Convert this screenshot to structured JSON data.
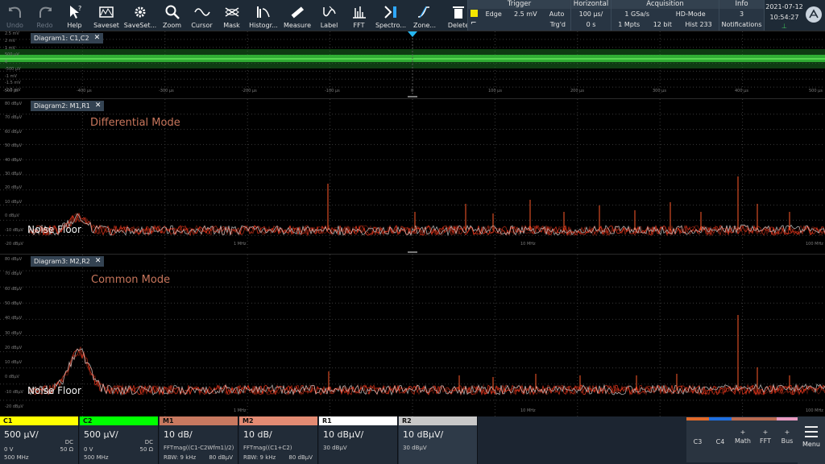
{
  "toolbar": {
    "buttons": [
      {
        "label": "Undo",
        "icon": "undo-icon"
      },
      {
        "label": "Redo",
        "icon": "redo-icon"
      },
      {
        "label": "Help",
        "icon": "help-cursor-icon"
      },
      {
        "label": "Saveset",
        "icon": "saveset-icon"
      },
      {
        "label": "SaveSet...",
        "icon": "saveset-gear-icon"
      },
      {
        "label": "Zoom",
        "icon": "zoom-icon"
      },
      {
        "label": "Cursor",
        "icon": "cursor-icon"
      },
      {
        "label": "Mask",
        "icon": "mask-icon"
      },
      {
        "label": "Histogr...",
        "icon": "histogram-icon"
      },
      {
        "label": "Measure",
        "icon": "measure-ruler-icon"
      },
      {
        "label": "Label",
        "icon": "label-icon"
      },
      {
        "label": "FFT",
        "icon": "fft-icon"
      },
      {
        "label": "Spectro...",
        "icon": "spectrogram-icon"
      },
      {
        "label": "Zone...",
        "icon": "zone-trigger-icon"
      },
      {
        "label": "Delete",
        "icon": "delete-trash-icon"
      }
    ],
    "trigger": {
      "title": "Trigger",
      "type": "Edge",
      "level": "2.5 mV",
      "mode": "Auto",
      "state": "Trg'd"
    },
    "horizontal": {
      "title": "Horizontal",
      "scale": "100 µs/",
      "position": "0 s"
    },
    "acquisition": {
      "title": "Acquisition",
      "rate": "1 GSa/s",
      "mode": "HD-Mode",
      "points": "1 Mpts",
      "bits": "12 bit",
      "hist": "Hist 233"
    },
    "info": {
      "title": "Info",
      "count": "3",
      "label": "Notifications"
    },
    "clock": {
      "date": "2021-07-12",
      "time": "10:54:27"
    }
  },
  "diagram1": {
    "title": "Diagram1: C1,C2",
    "y_labels": [
      "2.5 mV",
      "2 mV",
      "1 mV",
      "500 µV",
      "0",
      "-500 µV",
      "-1 mV",
      "-1.5 mV",
      "-2.5 mV"
    ],
    "x_labels": [
      "-500 µs",
      "-400 µs",
      "-300 µs",
      "-200 µs",
      "-100 µs",
      "0",
      "100 µs",
      "200 µs",
      "300 µs",
      "400 µs",
      "500 µs"
    ]
  },
  "diagram2": {
    "title": "Diagram2: M1,R1",
    "annotation": "Differential Mode",
    "noise_label": "Noise Floor",
    "y_labels": [
      "80 dBµV",
      "70 dBµV",
      "60 dBµV",
      "50 dBµV",
      "40 dBµV",
      "30 dBµV",
      "20 dBµV",
      "10 dBµV",
      "0 dBµV",
      "-10 dBµV",
      "-20 dBµV"
    ],
    "x_labels": [
      "1 MHz",
      "10 MHz",
      "100 MHz"
    ]
  },
  "diagram3": {
    "title": "Diagram3: M2,R2",
    "annotation": "Common Mode",
    "noise_label": "Noise Floor",
    "y_labels": [
      "80 dBµV",
      "70 dBµV",
      "60 dBµV",
      "50 dBµV",
      "40 dBµV",
      "30 dBµV",
      "20 dBµV",
      "10 dBµV",
      "0 dBµV",
      "-10 dBµV",
      "-20 dBµV"
    ],
    "x_labels": [
      "1 MHz",
      "10 MHz",
      "100 MHz"
    ]
  },
  "channels": [
    {
      "name": "C1",
      "scale": "500 µV/",
      "coupling": "DC",
      "offset": "0 V",
      "impedance": "50 Ω",
      "bandwidth": "500 MHz",
      "color": "#ffff00"
    },
    {
      "name": "C2",
      "scale": "500 µV/",
      "coupling": "DC",
      "offset": "0 V",
      "impedance": "50 Ω",
      "bandwidth": "500 MHz",
      "color": "#00ff00"
    },
    {
      "name": "M1",
      "scale": "10 dB/",
      "formula": "FFTmag((C1-C2Wfm1)/2)",
      "rbw": "RBW: 9 kHz",
      "ref": "80 dBµV",
      "color": "#c87960"
    },
    {
      "name": "M2",
      "scale": "10 dB/",
      "formula": "FFTmag((C1+C2)",
      "rbw": "RBW: 9 kHz",
      "ref": "80 dBµV",
      "color": "#e38b73"
    },
    {
      "name": "R1",
      "scale": "10 dBµV/",
      "ref": "30 dBµV",
      "color": "#ffffff"
    },
    {
      "name": "R2",
      "scale": "10 dBµV/",
      "ref": "30 dBµV",
      "color": "#c8c8c8"
    }
  ],
  "side_buttons": [
    {
      "name": "C3",
      "plus": "",
      "color": "#e06a2a"
    },
    {
      "name": "C4",
      "plus": "",
      "color": "#1f6fe0"
    },
    {
      "name": "Math",
      "plus": "+",
      "color": "#b86a50"
    },
    {
      "name": "FFT",
      "plus": "+",
      "color": "#b86a50"
    },
    {
      "name": "Bus",
      "plus": "+",
      "color": "#e89ac0"
    }
  ],
  "menu": {
    "label": "Menu"
  }
}
